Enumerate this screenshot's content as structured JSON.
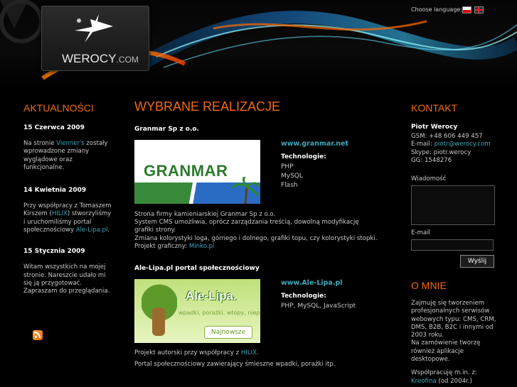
{
  "header": {
    "logo_text": "WEROCY",
    "logo_suffix": ".COM",
    "language_label": "Choose language:",
    "languages": [
      "pl",
      "en"
    ]
  },
  "left": {
    "title": "AKTUALNOŚCI",
    "news": [
      {
        "date": "15 Czerwca 2009",
        "text_before": "Na stronie ",
        "link": "Vienner's",
        "text_after": " zostały wprowadzone zmiany wyglądowe oraz funkcjonalne."
      },
      {
        "date": "14 Kwietnia 2009",
        "text_before": "Przy współpracy z Tomaszem Kirszem (",
        "link": "HILIX",
        "text_mid": ") stworzyliśmy i uruchomiliśmy portal społecznościowy ",
        "link2": "Ale-Lipa.pl",
        "text_after": "."
      },
      {
        "date": "15 Stycznia 2009",
        "text": "Witam wszystkich na mojej stronie. Nareszcie udało mi się ją przygotować. Zapraszam do przeglądania."
      }
    ],
    "rss_icon": "rss-icon"
  },
  "main": {
    "title": "WYBRANE REALIZACJE",
    "tech_label": "Technologie:",
    "projects": [
      {
        "name": "Granmar Sp z o.o.",
        "url": "www.granmar.net",
        "thumb_text": "GRANMAR",
        "tech": [
          "PHP",
          "MySQL",
          "Flash"
        ],
        "desc1": "Strona firmy kamieniarskiej Granmar Sp z o.o.",
        "desc2": "System CMS umożliwia, oprócz zarządzania treścią, dowolną modyfikację grafiki strony.",
        "desc3": "Zmiana kolorystyki loga, górnego i dolnego, grafiki topu, czy kolorystyki stopki.",
        "desc4_before": "Projekt graficzny: ",
        "desc4_link": "Minko.pl"
      },
      {
        "name": "Ale-Lipa.pl portal społecznościowy",
        "url": "www.Ale-Lipa.pl",
        "thumb_text": "Ale-Lipa.",
        "thumb_tag": "wpadki, porażki, wtopy, niep",
        "thumb_button": "Najnowsze",
        "tech": [
          "PHP, MySQL, JavaScript"
        ],
        "desc1_before": "Projekt autorski przy współpracy z ",
        "desc1_link": "HILIX",
        "desc1_after": ".",
        "desc2": "Portal społecznościowy zawierający śmieszne wpadki, porażki itp."
      }
    ]
  },
  "right": {
    "contact_title": "KONTAKT",
    "name": "Piotr Werocy",
    "gsm": "GSM: +48 606 449 457",
    "email_label": "E-mail: ",
    "email": "piotr@werocy.com",
    "skype": "Skype: piotr.werocy",
    "gg": "GG: 1548276",
    "message_label": "Wiadomość",
    "email_field_label": "E-mail",
    "send_label": "Wyślij",
    "about_title": "O MNIE",
    "about1": "Zajmuję się tworzeniem profesjonalnych serwisów webowych typu: CMS, CRM, DMS, B2B, B2C i innymi od 2003 roku.",
    "about2": "Na zamówienie tworzę również aplikacje desktopowe.",
    "about3": "Współpracuję m.in. z:",
    "about_link": "Kreofina",
    "about_link_after": " (od 2004r.)"
  }
}
